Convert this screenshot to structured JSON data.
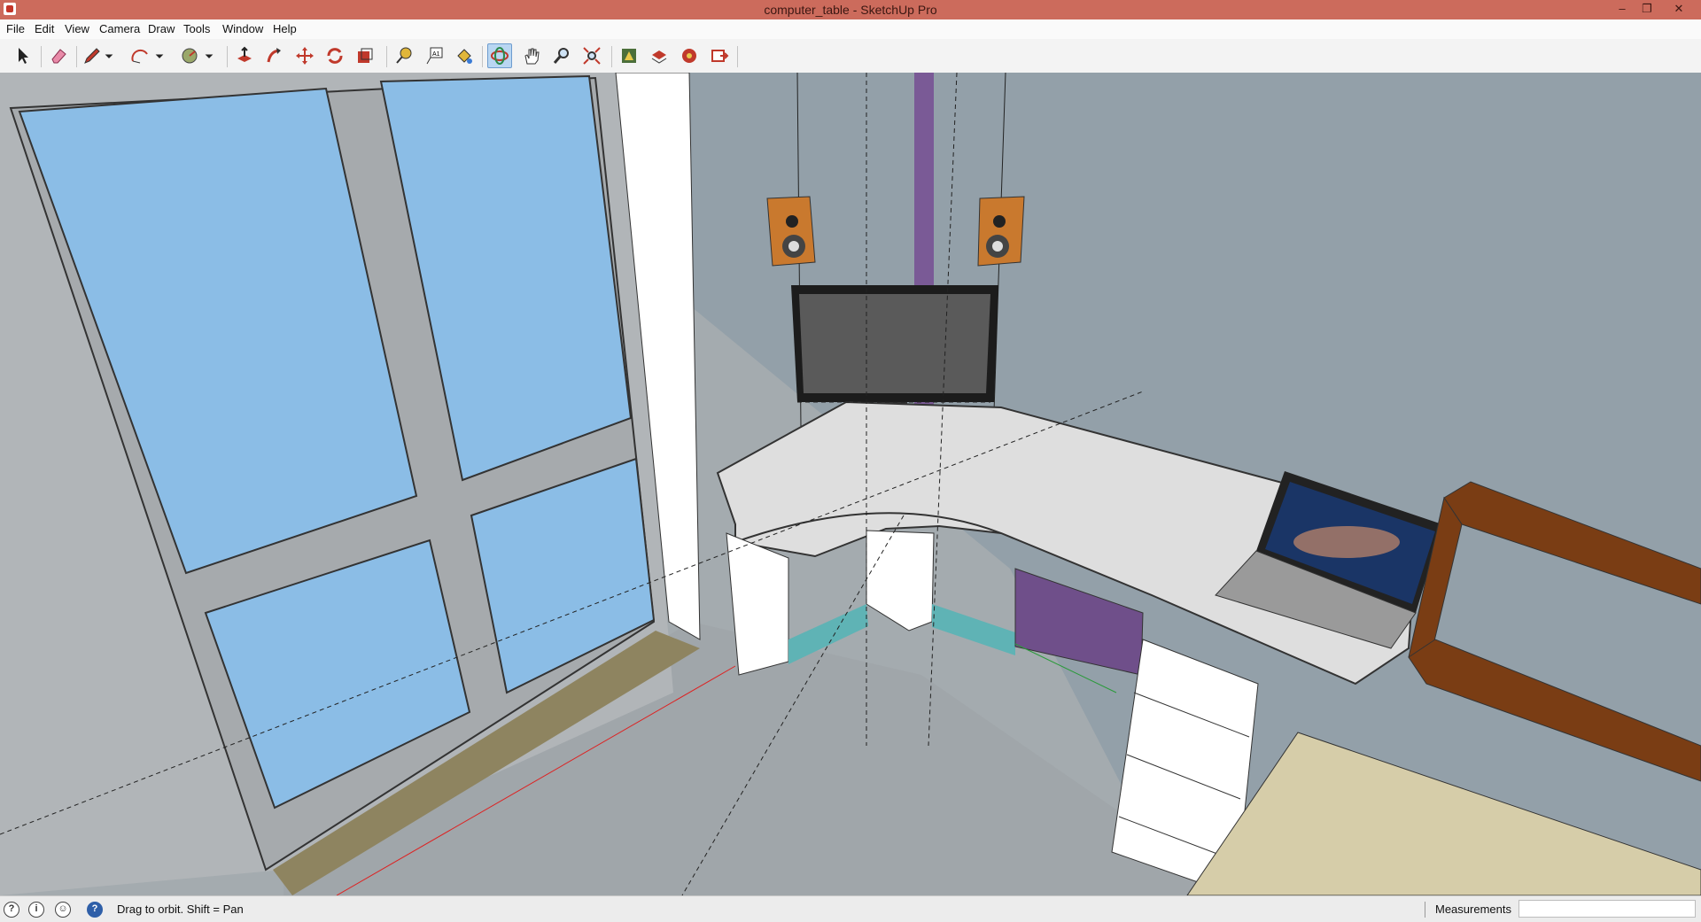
{
  "window": {
    "title": "computer_table - SketchUp Pro",
    "controls": {
      "minimize": "‒",
      "restore": "❐",
      "close": "✕"
    }
  },
  "menu": [
    "File",
    "Edit",
    "View",
    "Camera",
    "Draw",
    "Tools",
    "Window",
    "Help"
  ],
  "toolbar": {
    "tools": [
      {
        "name": "select-tool-icon"
      },
      {
        "name": "eraser-tool-icon"
      },
      {
        "name": "pencil-line-tool-icon"
      },
      {
        "name": "arc-tool-icon"
      },
      {
        "name": "shape-tool-icon"
      },
      {
        "name": "push-pull-tool-icon"
      },
      {
        "name": "follow-me-tool-icon"
      },
      {
        "name": "move-tool-icon"
      },
      {
        "name": "rotate-tool-icon"
      },
      {
        "name": "scale-tool-icon"
      },
      {
        "name": "tape-measure-tool-icon"
      },
      {
        "name": "text-tool-icon"
      },
      {
        "name": "paint-bucket-tool-icon"
      },
      {
        "name": "orbit-tool-icon",
        "active": true
      },
      {
        "name": "pan-tool-icon"
      },
      {
        "name": "zoom-tool-icon"
      },
      {
        "name": "zoom-extents-tool-icon"
      },
      {
        "name": "3d-warehouse-icon"
      },
      {
        "name": "extension-warehouse-icon"
      },
      {
        "name": "layout-icon"
      },
      {
        "name": "send-to-layout-icon"
      }
    ]
  },
  "status": {
    "hint": "Drag to orbit.  Shift = Pan",
    "measurements_label": "Measurements",
    "measurements_value": ""
  },
  "colors": {
    "titlebar": "#cc6b5c",
    "sky_glass": "#8bbde6",
    "wall": "#a7adb1",
    "desk": "#dcdcdc",
    "teal_baseboard": "#5fb3b5",
    "purple_panel": "#6f4f8a",
    "shelf_wood": "#7a3d14",
    "floor_tan": "#d6cda9"
  }
}
